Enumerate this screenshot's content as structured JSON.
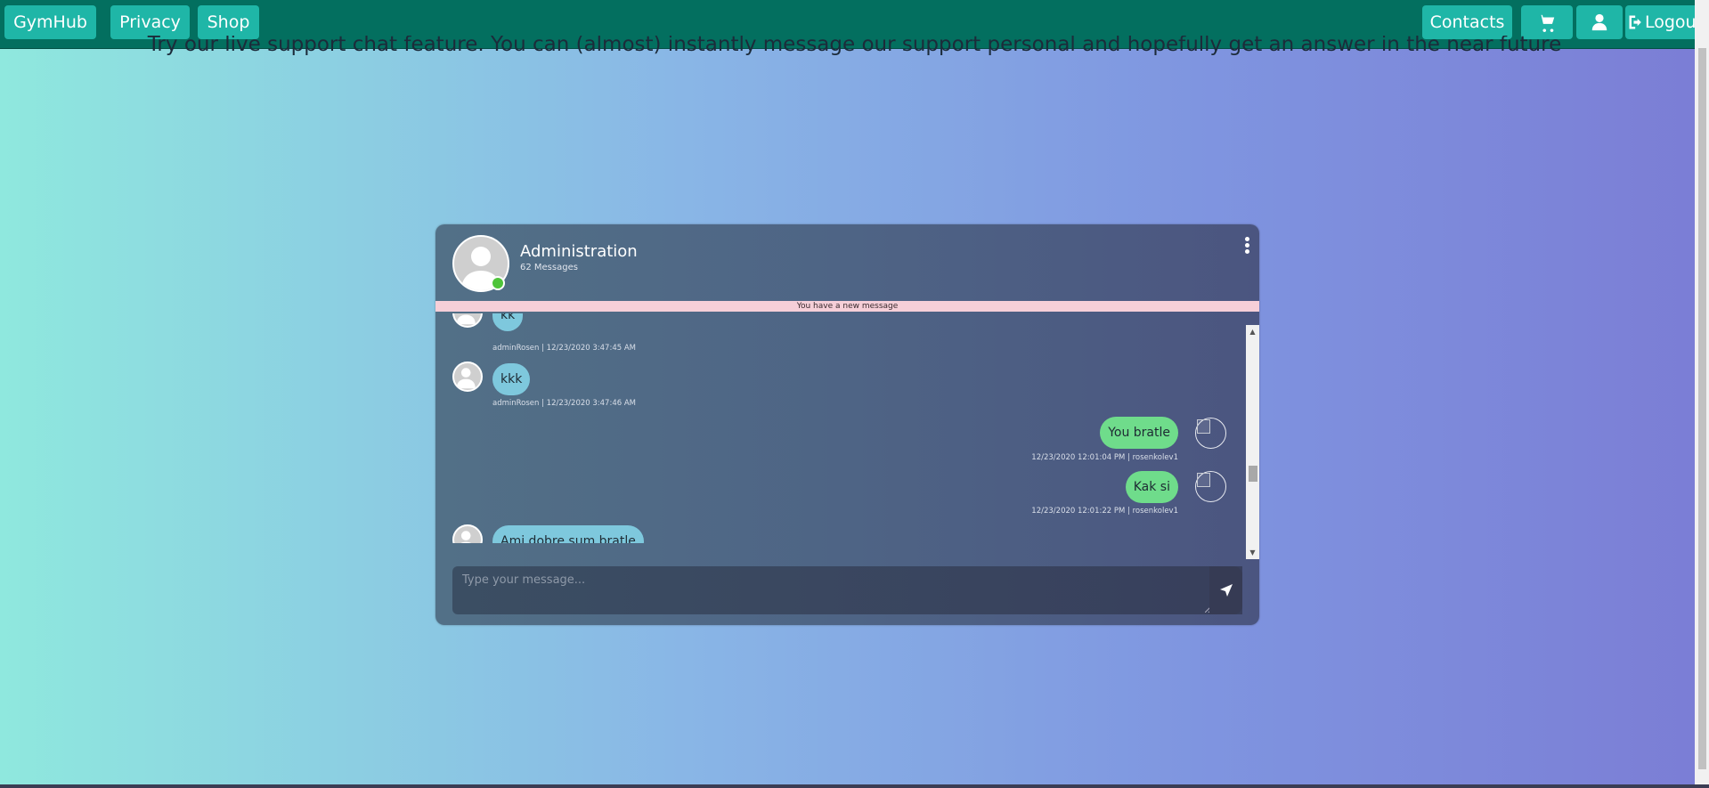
{
  "navbar": {
    "brand": "GymHub",
    "privacy": "Privacy",
    "shop": "Shop",
    "contacts": "Contacts",
    "logout": "Logout"
  },
  "intro_text": "Try our live support chat feature. You can (almost) instantly message our support personal and hopefully get an answer in the near future",
  "chat": {
    "title": "Administration",
    "message_count": "62 Messages",
    "new_message_banner": "You have a new message",
    "input_placeholder": "Type your message...",
    "messages": [
      {
        "direction": "in",
        "text": "kk",
        "meta": "adminRosen | 12/23/2020 3:47:45 AM"
      },
      {
        "direction": "in",
        "text": "kkk",
        "meta": "adminRosen | 12/23/2020 3:47:46 AM"
      },
      {
        "direction": "out",
        "text": "You bratle",
        "meta": "12/23/2020 12:01:04 PM | rosenkolev1"
      },
      {
        "direction": "out",
        "text": "Kak si",
        "meta": "12/23/2020 12:01:22 PM | rosenkolev1"
      },
      {
        "direction": "in",
        "text": "Ami dobre sum bratle",
        "meta": ""
      }
    ]
  },
  "colors": {
    "navbar": "#036f5f",
    "nav_button": "#1fb6a7",
    "bubble_in": "#7ec8dd",
    "bubble_out": "#6fdc8b",
    "banner": "#f6cfd8",
    "online": "#4ec43a"
  },
  "icons": [
    "cart-icon",
    "user-icon",
    "logout-icon",
    "kebab-menu-icon",
    "send-icon",
    "person-avatar-icon"
  ]
}
